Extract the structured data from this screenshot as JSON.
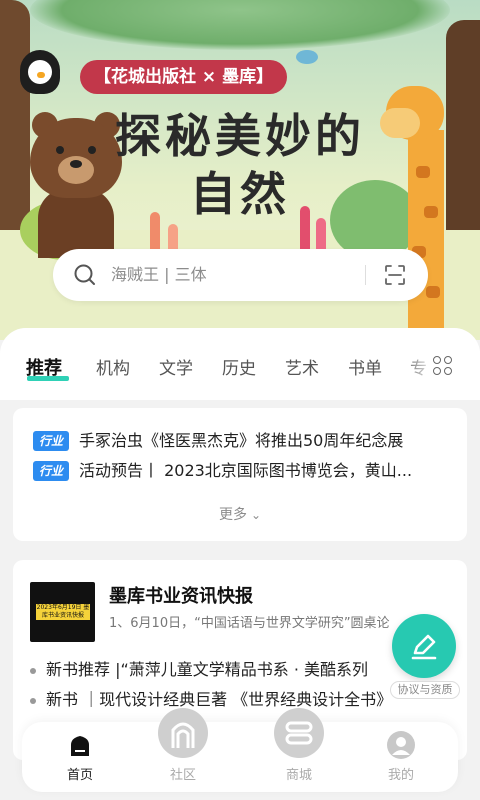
{
  "banner": {
    "publisher_pill": "【花城出版社 × 墨库】",
    "title_line1": "探秘美妙的",
    "title_line2": "自然"
  },
  "search": {
    "placeholder": "海贼王 | 三体",
    "icon": "search-icon",
    "scan_icon": "scan-icon"
  },
  "tabs": {
    "items": [
      "推荐",
      "机构",
      "文学",
      "历史",
      "艺术",
      "书单",
      "专"
    ],
    "active_index": 0,
    "grid_icon": "category-grid-icon"
  },
  "news": {
    "badge": "行业",
    "items": [
      "手冢治虫《怪医黑杰克》将推出50周年纪念展",
      "活动预告丨 2023北京国际图书博览会，黄山..."
    ],
    "more": "更多",
    "more_icon": "chevron-down-icon"
  },
  "bulletin": {
    "thumb_text": "2023年6月19日 墨库书业资讯快报",
    "title": "墨库书业资讯快报",
    "subtitle": "1、6月10日，“中国话语与世界文学研究”圆桌论",
    "items": [
      "新书推荐 |“萧萍儿童文学精品书系 · 美酷系列",
      "新书 ｜现代设计经典巨著 《世界经典设计全书》"
    ]
  },
  "fab": {
    "icon": "edit-pen-icon",
    "label": "协议与资质"
  },
  "bottom_nav": {
    "items": [
      {
        "label": "首页",
        "icon": "home-icon",
        "active": true
      },
      {
        "label": "社区",
        "icon": "community-icon",
        "active": false
      },
      {
        "label": "商城",
        "icon": "shop-icon",
        "active": false
      },
      {
        "label": "我的",
        "icon": "profile-icon",
        "active": false
      }
    ]
  },
  "colors": {
    "accent": "#2fd1b6",
    "badge_blue": "#2d8cf0",
    "fab": "#27c9b1",
    "pill": "#c2374a"
  }
}
